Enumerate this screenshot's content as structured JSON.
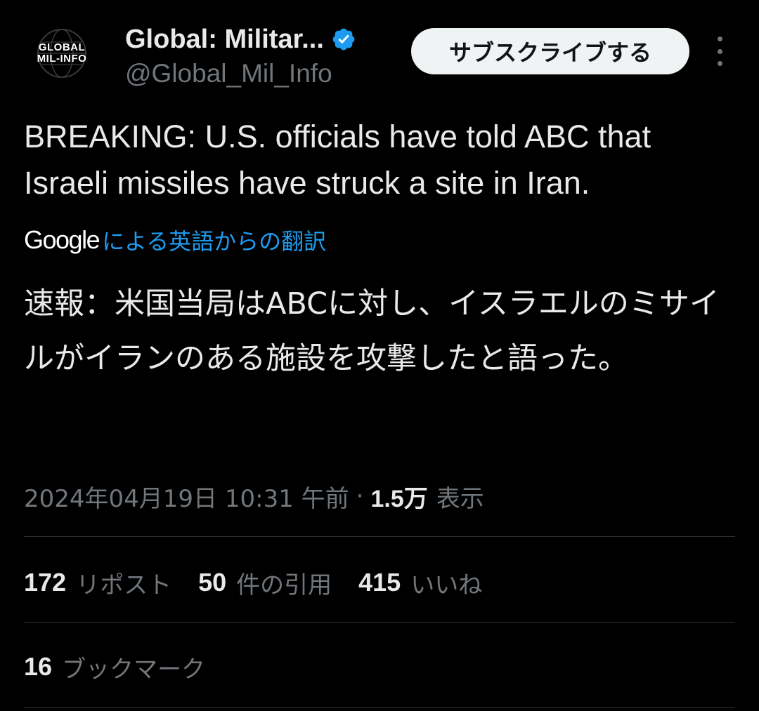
{
  "header": {
    "avatar": {
      "line1": "GLOBAL",
      "line2": "MIL-INFO",
      "icon": "globe-logo"
    },
    "display_name": "Global: Militar...",
    "verified_icon": "verified-badge-icon",
    "verified_color": "#1d9bf0",
    "handle": "@Global_Mil_Info",
    "subscribe_label": "サブスクライブする",
    "more_icon": "more-vertical-icon"
  },
  "tweet": {
    "text": "BREAKING: U.S. officials have told ABC that Israeli missiles have struck a site in Iran.",
    "translate": {
      "brand": "Google",
      "link": "による英語からの翻訳",
      "link_color": "#1d9bf0"
    },
    "translated_text": "速報：米国当局はABCに対し、イスラエルのミサイルがイランのある施設を攻撃したと語った。"
  },
  "meta": {
    "timestamp": "2024年04月19日 10:31 午前",
    "separator": "·",
    "views_count": "1.5万",
    "views_label": "表示"
  },
  "stats": {
    "reposts": {
      "count": "172",
      "label": "リポスト"
    },
    "quotes": {
      "count": "50",
      "label": "件の引用"
    },
    "likes": {
      "count": "415",
      "label": "いいね"
    },
    "bookmarks": {
      "count": "16",
      "label": "ブックマーク"
    }
  }
}
